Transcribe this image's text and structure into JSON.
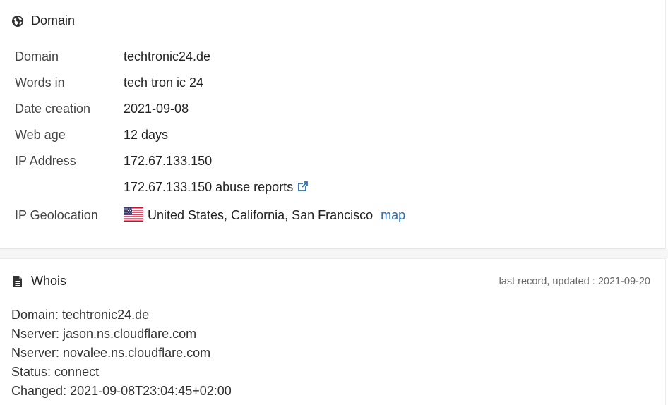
{
  "domain_section": {
    "title": "Domain",
    "rows": [
      {
        "label": "Domain",
        "value": "techtronic24.de"
      },
      {
        "label": "Words in",
        "value": "tech tron ic 24"
      },
      {
        "label": "Date creation",
        "value": "2021-09-08"
      },
      {
        "label": "Web age",
        "value": "12 days"
      },
      {
        "label": "IP Address",
        "value": "172.67.133.150"
      },
      {
        "label": "",
        "value": "172.67.133.150 abuse reports"
      },
      {
        "label": "IP Geolocation",
        "value": "United States, California, San Francisco",
        "link": "map"
      }
    ],
    "colors": {
      "link": "#2a6db2"
    }
  },
  "whois_section": {
    "title": "Whois",
    "updated": "last record, updated : 2021-09-20",
    "lines": [
      "Domain: techtronic24.de",
      "Nserver: jason.ns.cloudflare.com",
      "Nserver: novalee.ns.cloudflare.com",
      "Status: connect",
      "Changed: 2021-09-08T23:04:45+02:00"
    ]
  },
  "icons": {
    "domain": "globe-icon",
    "whois": "document-icon",
    "external": "external-link-icon",
    "flag": "us-flag-icon"
  }
}
